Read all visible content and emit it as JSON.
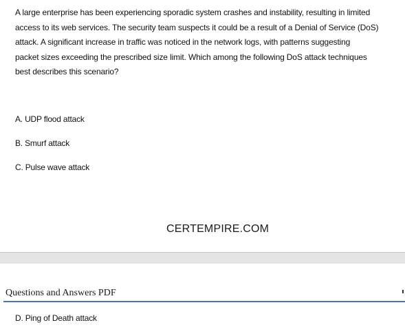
{
  "question": {
    "lines": [
      "A large enterprise has been experiencing sporadic system crashes and instability, resulting in limited",
      "access to its web services. The security team suspects it could be a result of a Denial of Service (DoS)",
      "attack. A significant increase in traffic was noticed in the network logs, with patterns suggesting",
      "packet sizes exceeding the prescribed size limit. Which among the following DoS attack techniques",
      "best describes this scenario?"
    ]
  },
  "options": {
    "a": "A. UDP flood attack",
    "b": "B. Smurf attack",
    "c": "C. Pulse wave attack",
    "d": "D. Ping of Death attack"
  },
  "watermark": "CERTEMPIRE.COM",
  "page_header": {
    "title": "Questions and Answers PDF"
  },
  "colors": {
    "header_rule": "#4472c4",
    "page_gap": "#e4e4e4"
  }
}
